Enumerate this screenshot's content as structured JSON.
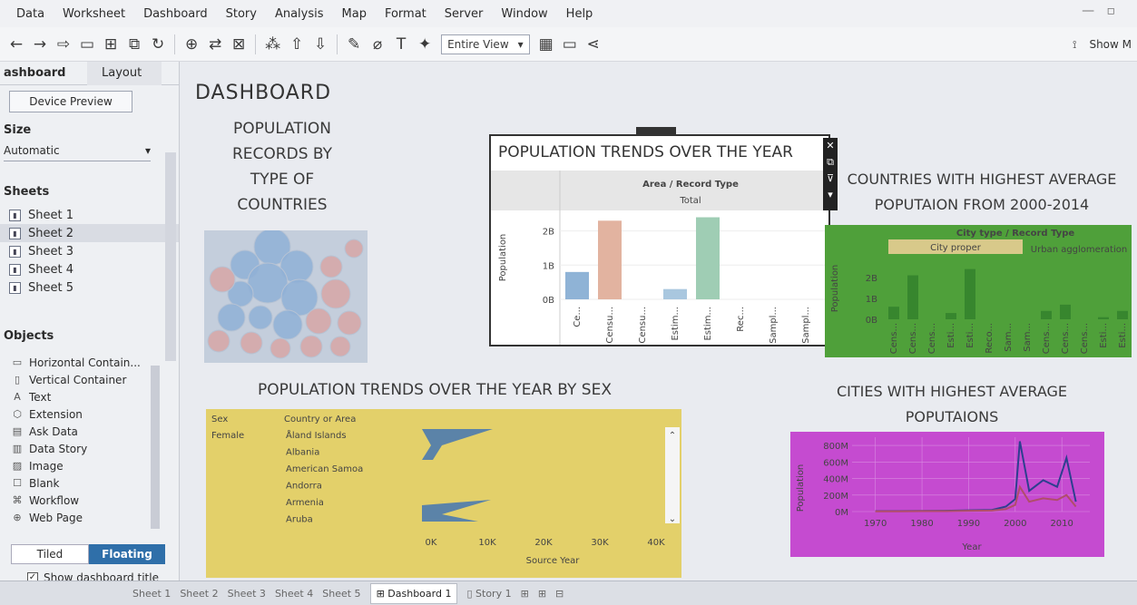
{
  "menu": [
    "Data",
    "Worksheet",
    "Dashboard",
    "Story",
    "Analysis",
    "Map",
    "Format",
    "Server",
    "Window",
    "Help"
  ],
  "toolbar": {
    "view_select": "Entire View",
    "show_me": "Show M"
  },
  "left_pane": {
    "tab_dashboard": "ashboard",
    "tab_layout": "Layout",
    "device_preview": "Device Preview",
    "size_title": "Size",
    "size_value": "Automatic",
    "sheets_title": "Sheets",
    "sheets": [
      "Sheet 1",
      "Sheet 2",
      "Sheet 3",
      "Sheet 4",
      "Sheet 5"
    ],
    "objects_title": "Objects",
    "objects": [
      {
        "label": "Horizontal Contain...",
        "icon": "horizontal-container-icon"
      },
      {
        "label": "Vertical Container",
        "icon": "vertical-container-icon"
      },
      {
        "label": "Text",
        "icon": "text-icon"
      },
      {
        "label": "Extension",
        "icon": "extension-icon"
      },
      {
        "label": "Ask Data",
        "icon": "ask-data-icon"
      },
      {
        "label": "Data Story",
        "icon": "data-story-icon"
      },
      {
        "label": "Image",
        "icon": "image-icon"
      },
      {
        "label": "Blank",
        "icon": "blank-icon"
      },
      {
        "label": "Workflow",
        "icon": "workflow-icon"
      },
      {
        "label": "Web Page",
        "icon": "web-page-icon"
      }
    ],
    "tiled": "Tiled",
    "floating": "Floating",
    "show_title": "Show dashboard title"
  },
  "dashboard": {
    "title": "DASHBOARD",
    "chart1_title_lines": [
      "POPULATION",
      "RECORDS BY",
      "TYPE OF",
      "COUNTRIES"
    ],
    "chart2_title": "POPULATION TRENDS OVER THE YEAR",
    "chart3_title_lines": [
      "COUNTRIES WITH HIGHEST AVERAGE",
      "POPUTAION FROM 2000-2014"
    ],
    "chart4_title": "POPULATION TRENDS OVER THE YEAR BY SEX",
    "chart5_title_lines": [
      "CITIES WITH HIGHEST AVERAGE",
      "POPUTAIONS"
    ]
  },
  "colors": {
    "accent": "#2f6fa9",
    "green_panel": "#4fa03a",
    "yellow_panel": "#e3d06a",
    "magenta_panel": "#c54bd0",
    "bubble_blue": "#8fb0d6",
    "bubble_red": "#d7a6a6"
  },
  "chart_data": [
    {
      "type": "bar",
      "title": "POPULATION TRENDS OVER THE YEAR",
      "header": "Area / Record Type",
      "subheader": "Total",
      "ylabel": "Population",
      "yticks": [
        "0B",
        "1B",
        "2B"
      ],
      "ylim": [
        0,
        2.6
      ],
      "categories": [
        "Ce...",
        "Censu...",
        "Censu...",
        "Estim...",
        "Estim...",
        "Rec...",
        "Sampl...",
        "Sampl..."
      ],
      "values": [
        0.8,
        2.3,
        0.0,
        0.3,
        2.4,
        0.0,
        0.0,
        0.0
      ],
      "bar_colors": [
        "#8fb3d6",
        "#e2b3a0",
        "#c8c8c8",
        "#a9c7df",
        "#9fcdb4",
        "#c8c8c8",
        "#c8c8c8",
        "#c8c8c8"
      ]
    },
    {
      "type": "bar",
      "title": "COUNTRIES WITH HIGHEST AVERAGE POPUTAION FROM 2000-2014",
      "header": "City type / Record Type",
      "groups": [
        "City proper",
        "Urban agglomeration"
      ],
      "ylabel": "Population",
      "yticks": [
        "0B",
        "1B",
        "2B"
      ],
      "ylim": [
        0,
        2.6
      ],
      "categories": [
        "Cens...",
        "Cens...",
        "Cens...",
        "Esti...",
        "Esti...",
        "Reco...",
        "Sam...",
        "Sam...",
        "Cens...",
        "Cens...",
        "Cens...",
        "Esti...",
        "Esti..."
      ],
      "values": [
        0.6,
        2.1,
        0.0,
        0.3,
        2.4,
        0.0,
        0.0,
        0.0,
        0.4,
        0.7,
        0.0,
        0.1,
        0.4
      ]
    },
    {
      "type": "bar",
      "title": "POPULATION TRENDS OVER THE YEAR BY SEX",
      "row_header_1": "Sex",
      "row_header_2": "Country or Area",
      "sex": "Female",
      "rows": [
        "Åland Islands",
        "Albania",
        "American Samoa",
        "Andorra",
        "Armenia",
        "Aruba"
      ],
      "xlabel": "Source Year",
      "xticks": [
        "0K",
        "10K",
        "20K",
        "30K",
        "40K"
      ]
    },
    {
      "type": "line",
      "title": "CITIES WITH HIGHEST AVERAGE POPUTAIONS",
      "xlabel": "Year",
      "ylabel": "Population",
      "x": [
        1970,
        1975,
        1980,
        1985,
        1990,
        1995,
        1998,
        2000,
        2001,
        2003,
        2006,
        2009,
        2011,
        2013
      ],
      "xticks": [
        "1970",
        "1980",
        "1990",
        "2000",
        "2010"
      ],
      "yticks": [
        "0M",
        "200M",
        "400M",
        "600M",
        "800M"
      ],
      "ylim": [
        0,
        900
      ],
      "series": [
        {
          "values": [
            5,
            5,
            8,
            10,
            15,
            20,
            60,
            150,
            850,
            250,
            380,
            300,
            650,
            120
          ]
        },
        {
          "values": [
            3,
            3,
            5,
            6,
            10,
            12,
            30,
            80,
            300,
            120,
            160,
            140,
            200,
            60
          ]
        }
      ]
    }
  ],
  "bottom_tabs": [
    "Sheet 1",
    "Sheet 2",
    "Sheet 3",
    "Sheet 4",
    "Sheet 5",
    "Dashboard 1",
    "Story 1"
  ]
}
